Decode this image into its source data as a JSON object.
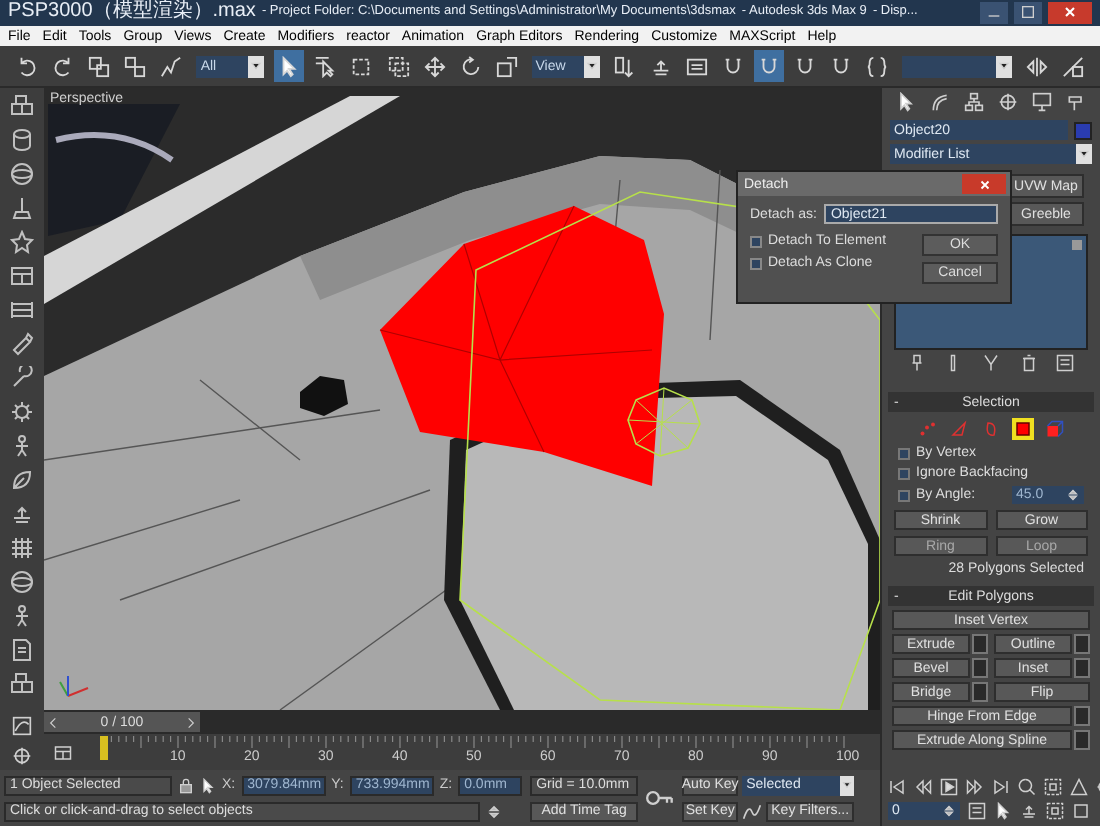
{
  "window": {
    "title_parts": [
      "PSP3000（模型渲染）.max",
      "- Project Folder: C:\\Documents and Settings\\Administrator\\My Documents\\3dsmax",
      "- Autodesk 3ds Max 9",
      "- Disp..."
    ]
  },
  "menu": [
    "File",
    "Edit",
    "Tools",
    "Group",
    "Views",
    "Create",
    "Modifiers",
    "reactor",
    "Animation",
    "Graph Editors",
    "Rendering",
    "Customize",
    "MAXScript",
    "Help"
  ],
  "toolbar": [
    {
      "kind": "tool",
      "selected": false
    },
    {
      "kind": "tool",
      "selected": false
    },
    {
      "kind": "tool",
      "selected": false
    },
    {
      "kind": "tool",
      "selected": false
    },
    {
      "kind": "tool",
      "selected": false
    },
    {
      "kind": "dropdown",
      "value": "All"
    },
    {
      "kind": "tool",
      "selected": true
    },
    {
      "kind": "tool",
      "selected": false
    },
    {
      "kind": "tool",
      "selected": false
    },
    {
      "kind": "tool",
      "selected": false
    },
    {
      "kind": "tool",
      "selected": false
    },
    {
      "kind": "tool",
      "selected": false
    },
    {
      "kind": "tool",
      "selected": false
    },
    {
      "kind": "dropdown",
      "value": "View"
    },
    {
      "kind": "tool",
      "selected": false
    },
    {
      "kind": "tool",
      "selected": false
    },
    {
      "kind": "tool",
      "selected": false
    },
    {
      "kind": "tool",
      "selected": false
    },
    {
      "kind": "tool",
      "selected": true
    },
    {
      "kind": "tool",
      "selected": false
    },
    {
      "kind": "tool",
      "selected": false
    },
    {
      "kind": "tool",
      "selected": false
    },
    {
      "kind": "dropdown"
    },
    {
      "kind": "tool",
      "selected": false
    },
    {
      "kind": "tool",
      "selected": false
    }
  ],
  "viewport": {
    "label": "Perspective"
  },
  "detach_dialog": {
    "title": "Detach",
    "name_label": "Detach as:",
    "name_value": "Object21",
    "options": [
      {
        "label": "Detach To Element",
        "checked": false
      },
      {
        "label": "Detach As Clone",
        "checked": false
      }
    ],
    "buttons": [
      "OK",
      "Cancel"
    ]
  },
  "command_panel": {
    "object_name": "Object20",
    "modifier_list": "Modifier List",
    "modifier_buttons": [
      "UVW Map",
      "Greeble"
    ],
    "selection": {
      "toggle": "-",
      "title": "Selection",
      "levels": [
        {
          "selected": false
        },
        {
          "selected": false
        },
        {
          "selected": false
        },
        {
          "selected": true
        },
        {
          "selected": false
        }
      ],
      "options": [
        {
          "label": "By Vertex",
          "checked": false
        },
        {
          "label": "Ignore Backfacing",
          "checked": false
        },
        {
          "label": "By Angle:",
          "checked": false,
          "value": "45.0"
        }
      ],
      "buttons": [
        {
          "label": "Shrink",
          "disabled": false
        },
        {
          "label": "Grow",
          "disabled": false
        },
        {
          "label": "Ring",
          "disabled": true
        },
        {
          "label": "Loop",
          "disabled": true
        }
      ],
      "status": "28 Polygons Selected"
    },
    "edit_polygons": {
      "toggle": "-",
      "title": "Edit Polygons",
      "rows": [
        {
          "buttons": [
            {
              "label": "Inset Vertex",
              "settings": false
            }
          ]
        },
        {
          "buttons": [
            {
              "label": "Extrude",
              "settings": true
            },
            {
              "label": "Outline",
              "settings": true
            }
          ]
        },
        {
          "buttons": [
            {
              "label": "Bevel",
              "settings": true
            },
            {
              "label": "Inset",
              "settings": true
            }
          ]
        },
        {
          "buttons": [
            {
              "label": "Bridge",
              "settings": true
            },
            {
              "label": "Flip",
              "settings": false
            }
          ]
        },
        {
          "buttons": [
            {
              "label": "Hinge From Edge",
              "settings": true
            }
          ]
        },
        {
          "buttons": [
            {
              "label": "Extrude Along Spline",
              "settings": true
            }
          ]
        }
      ]
    }
  },
  "time_slider": {
    "frame_display": "0 / 100",
    "ruler_labels": [
      "10",
      "20",
      "30",
      "40",
      "50",
      "60",
      "70",
      "80",
      "90",
      "100"
    ]
  },
  "status_bar": {
    "selection_info": "1 Object Selected",
    "x_label": "X:",
    "x": "3079.84mm",
    "y_label": "Y:",
    "y": "733.994mm",
    "z_label": "Z:",
    "z": "0.0mm",
    "grid": "Grid = 10.0mm",
    "prompt": "Click or click-and-drag to select objects",
    "time_tag": "Add Time Tag",
    "auto_key": "Auto Key",
    "key_mode": "Selected",
    "set_key": "Set Key",
    "key_filters": "Key Filters..."
  },
  "playback": {
    "current_frame": "0"
  }
}
